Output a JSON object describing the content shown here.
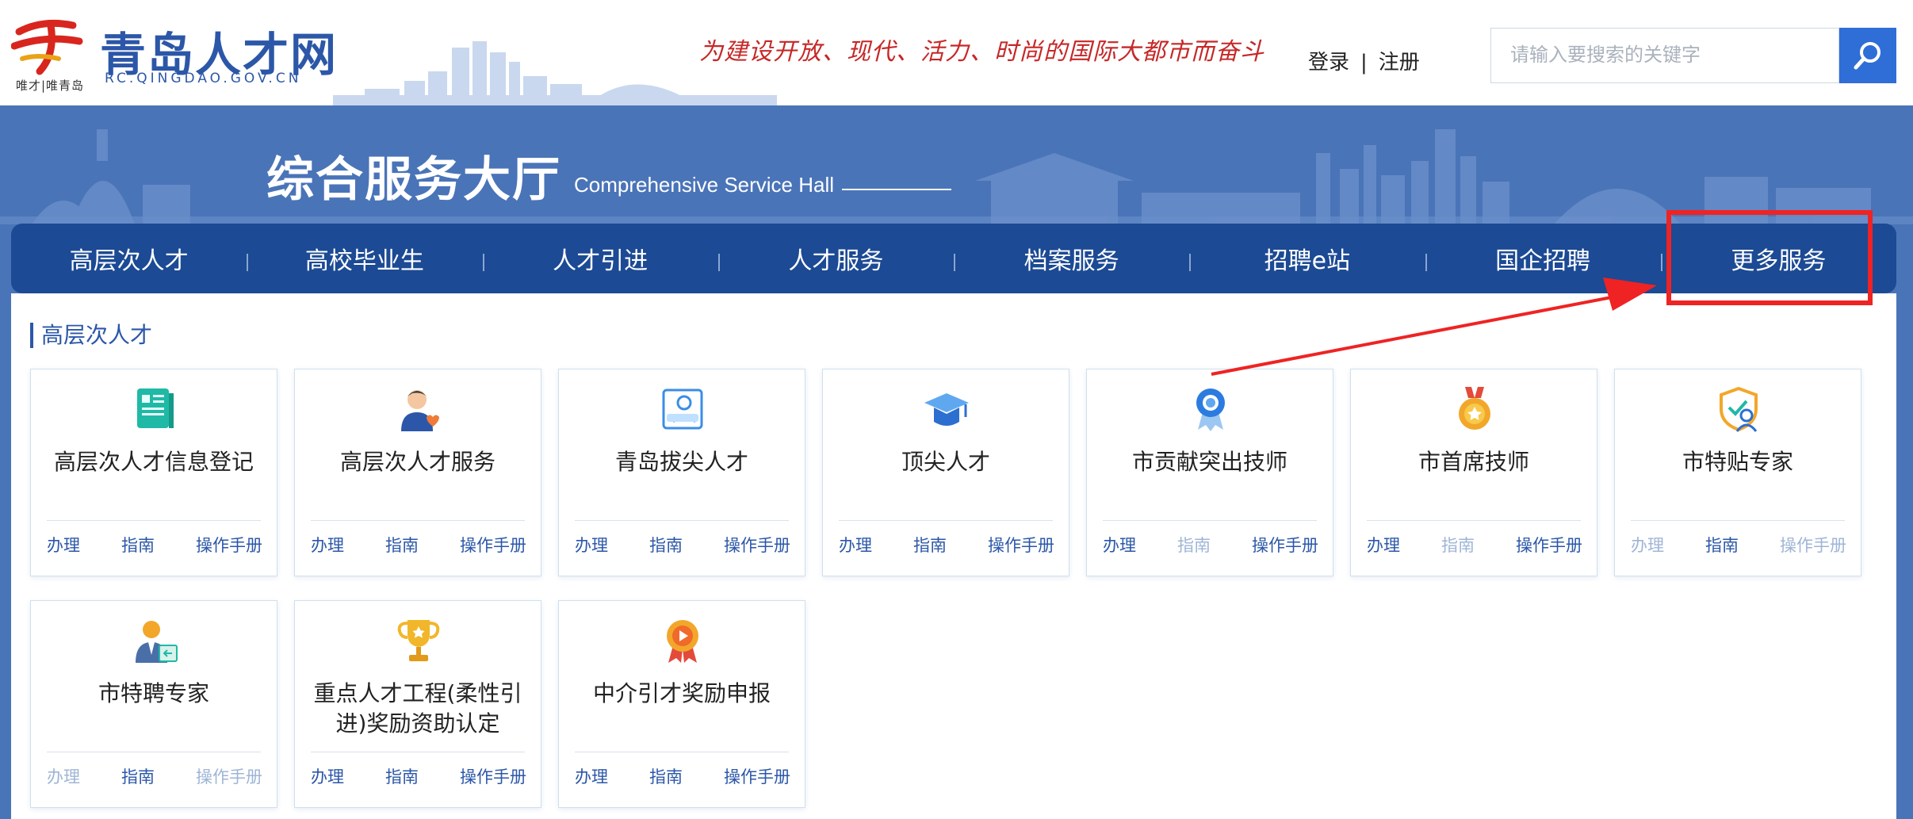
{
  "header": {
    "site_name": "青岛人才网",
    "site_domain": "RC.QINGDAO.GOV.CN",
    "logo_slogan": "唯才|唯青岛",
    "slogan": "为建设开放、现代、活力、时尚的国际大都市而奋斗",
    "login": "登录",
    "separator": "|",
    "register": "注册",
    "search_placeholder": "请输入要搜索的关键字"
  },
  "banner": {
    "title": "综合服务大厅",
    "subtitle": "Comprehensive Service Hall"
  },
  "nav": [
    "高层次人才",
    "高校毕业生",
    "人才引进",
    "人才服务",
    "档案服务",
    "招聘e站",
    "国企招聘",
    "更多服务"
  ],
  "section": {
    "title": "高层次人才"
  },
  "cards": [
    {
      "title": "高层次人才信息登记",
      "icon": "info-register-icon",
      "links": [
        {
          "label": "办理",
          "muted": false
        },
        {
          "label": "指南",
          "muted": false
        },
        {
          "label": "操作手册",
          "muted": false
        }
      ]
    },
    {
      "title": "高层次人才服务",
      "icon": "person-heart-icon",
      "links": [
        {
          "label": "办理",
          "muted": false
        },
        {
          "label": "指南",
          "muted": false
        },
        {
          "label": "操作手册",
          "muted": false
        }
      ]
    },
    {
      "title": "青岛拔尖人才",
      "icon": "talent-id-icon",
      "links": [
        {
          "label": "办理",
          "muted": false
        },
        {
          "label": "指南",
          "muted": false
        },
        {
          "label": "操作手册",
          "muted": false
        }
      ]
    },
    {
      "title": "顶尖人才",
      "icon": "graduation-cap-icon",
      "links": [
        {
          "label": "办理",
          "muted": false
        },
        {
          "label": "指南",
          "muted": false
        },
        {
          "label": "操作手册",
          "muted": false
        }
      ]
    },
    {
      "title": "市贡献突出技师",
      "icon": "rosette-icon",
      "links": [
        {
          "label": "办理",
          "muted": false
        },
        {
          "label": "指南",
          "muted": true
        },
        {
          "label": "操作手册",
          "muted": false
        }
      ]
    },
    {
      "title": "市首席技师",
      "icon": "medal-icon",
      "links": [
        {
          "label": "办理",
          "muted": false
        },
        {
          "label": "指南",
          "muted": true
        },
        {
          "label": "操作手册",
          "muted": false
        }
      ]
    },
    {
      "title": "市特贴专家",
      "icon": "shield-user-icon",
      "links": [
        {
          "label": "办理",
          "muted": true
        },
        {
          "label": "指南",
          "muted": false
        },
        {
          "label": "操作手册",
          "muted": true
        }
      ]
    },
    {
      "title": "市特聘专家",
      "icon": "expert-badge-icon",
      "links": [
        {
          "label": "办理",
          "muted": true
        },
        {
          "label": "指南",
          "muted": false
        },
        {
          "label": "操作手册",
          "muted": true
        }
      ]
    },
    {
      "title": "重点人才工程(柔性引进)奖励资助认定",
      "icon": "trophy-icon",
      "links": [
        {
          "label": "办理",
          "muted": false
        },
        {
          "label": "指南",
          "muted": false
        },
        {
          "label": "操作手册",
          "muted": false
        }
      ]
    },
    {
      "title": "中介引才奖励申报",
      "icon": "play-medal-icon",
      "links": [
        {
          "label": "办理",
          "muted": false
        },
        {
          "label": "指南",
          "muted": false
        },
        {
          "label": "操作手册",
          "muted": false
        }
      ]
    }
  ],
  "colors": {
    "primary": "#2c57a8",
    "nav": "#1c4a94",
    "banner": "#4a74b8",
    "annotation": "#ef2323"
  }
}
